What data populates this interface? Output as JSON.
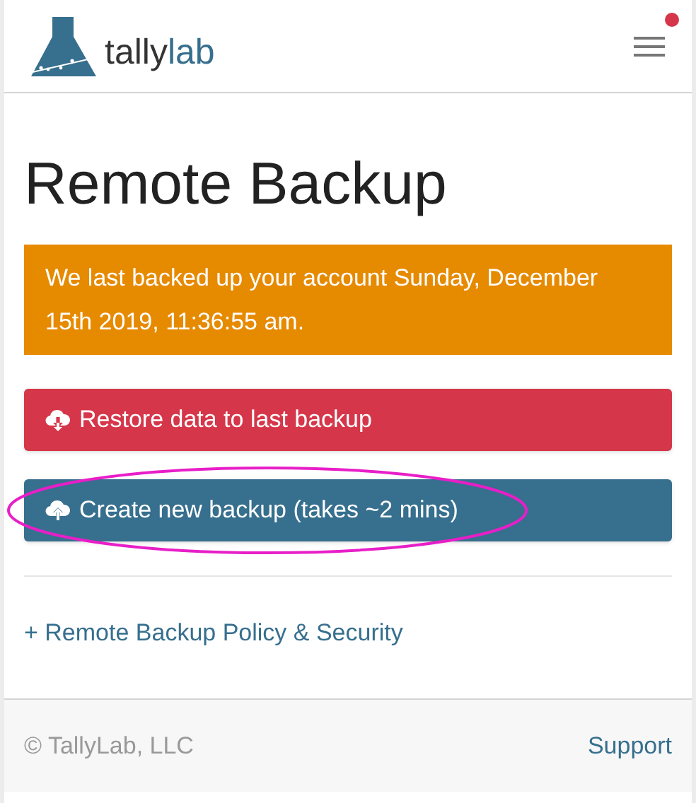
{
  "header": {
    "logo": {
      "part_1": "tally",
      "part_2": "lab"
    },
    "menu": {
      "notification": true
    }
  },
  "title": "Remote Backup",
  "alert": {
    "text": "We last backed up your account Sunday, December 15th 2019, 11:36:55 am."
  },
  "buttons": [
    {
      "kind": "restore",
      "label": "Restore data to last backup",
      "highlighted": false
    },
    {
      "kind": "create",
      "label": "Create new backup (takes ~2 mins)",
      "highlighted": true
    }
  ],
  "policy_link": "+ Remote Backup Policy & Security",
  "footer": {
    "copyright": "© TallyLab, LLC",
    "support": "Support"
  }
}
